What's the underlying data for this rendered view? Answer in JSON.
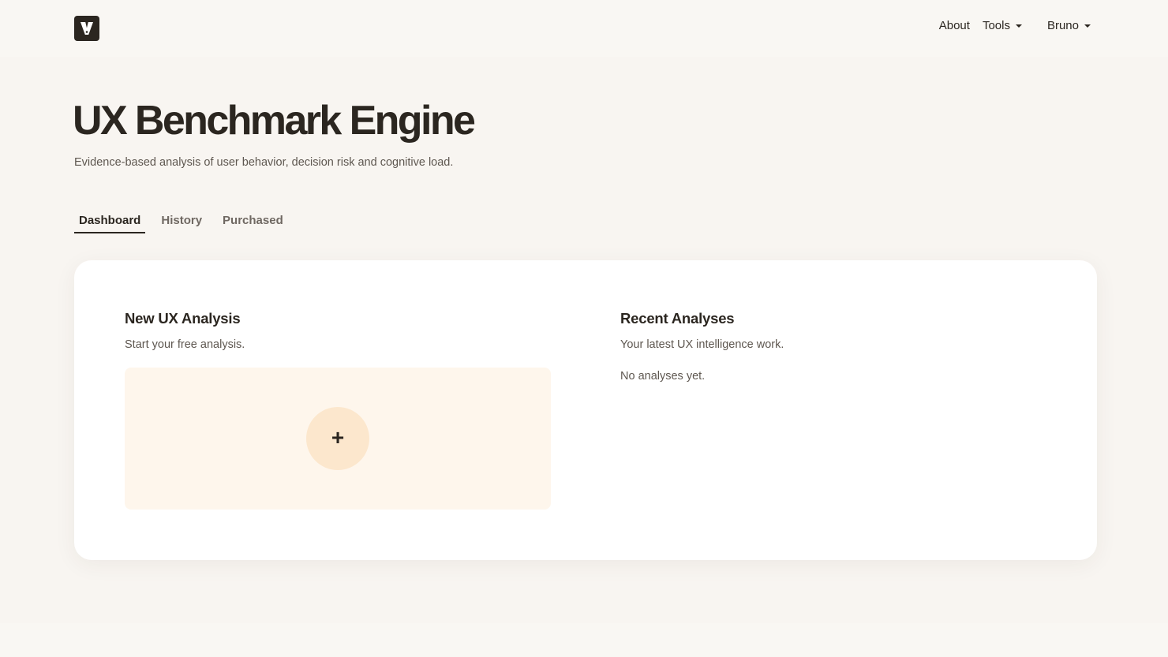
{
  "nav": {
    "about": "About",
    "tools": "Tools",
    "user": "Bruno"
  },
  "header": {
    "title": "UX Benchmark Engine",
    "subtitle": "Evidence-based analysis of user behavior, decision risk and cognitive load."
  },
  "tabs": [
    {
      "label": "Dashboard",
      "active": true
    },
    {
      "label": "History",
      "active": false
    },
    {
      "label": "Purchased",
      "active": false
    }
  ],
  "new_analysis": {
    "title": "New UX Analysis",
    "subtitle": "Start your free analysis.",
    "add_icon": "+"
  },
  "recent": {
    "title": "Recent Analyses",
    "subtitle": "Your latest UX intelligence work.",
    "empty": "No analyses yet."
  },
  "colors": {
    "brand_dark": "#2b2620",
    "background": "#f8f5f1",
    "dropzone": "#fef6ec",
    "add_button": "#fce7cd"
  }
}
